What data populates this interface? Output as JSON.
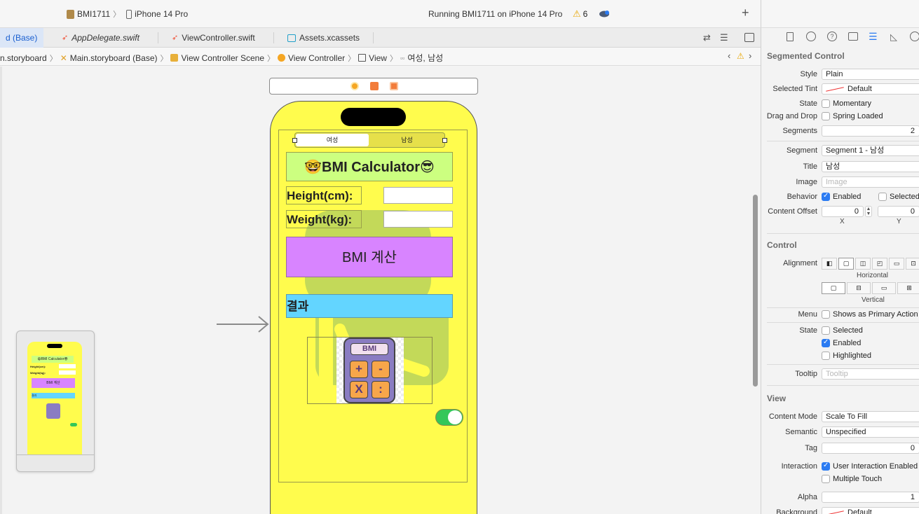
{
  "toolbar": {
    "project": "BMI1711",
    "device": "iPhone 14 Pro",
    "status": "Running BMI1711 on iPhone 14 Pro",
    "warning_count": "6",
    "add_label": "+"
  },
  "tabs": [
    {
      "label": "d (Base)"
    },
    {
      "label": "AppDelegate.swift"
    },
    {
      "label": "ViewController.swift"
    },
    {
      "label": "Assets.xcassets"
    }
  ],
  "breadcrumb": [
    "n.storyboard",
    "Main.storyboard (Base)",
    "View Controller Scene",
    "View Controller",
    "View",
    "여성, 남성"
  ],
  "app": {
    "segments": [
      "여성",
      "남성"
    ],
    "title": "🤓BMI Calculator😎",
    "height_label": "Height(cm):",
    "weight_label": "Weight(kg):",
    "calc_button": "BMI 계산",
    "result_label": "결과",
    "calc_image_label": "BMI",
    "calc_keys": [
      "+",
      "-",
      "X",
      ":"
    ],
    "switch_on": true
  },
  "thumbnail": {
    "title": "😃BMI Calculator😎",
    "height_label": "Height(cm):",
    "weight_label": "Weight(kg):",
    "calc_button": "BMI 계산",
    "result_label": "결과"
  },
  "inspector": {
    "section_segmented": "Segmented Control",
    "style_label": "Style",
    "style_value": "Plain",
    "tint_label": "Selected Tint",
    "tint_value": "Default",
    "state_label": "State",
    "state_value": "Momentary",
    "dnd_label": "Drag and Drop",
    "dnd_value": "Spring Loaded",
    "segments_label": "Segments",
    "segments_value": "2",
    "segment_label": "Segment",
    "segment_value": "Segment 1 - 남성",
    "title_label": "Title",
    "title_value": "남성",
    "image_label": "Image",
    "image_placeholder": "Image",
    "behavior_label": "Behavior",
    "behavior_enabled": "Enabled",
    "behavior_selected": "Selected",
    "offset_label": "Content Offset",
    "offset_x": "0",
    "offset_y": "0",
    "offset_x_caption": "X",
    "offset_y_caption": "Y",
    "section_control": "Control",
    "alignment_label": "Alignment",
    "horizontal_caption": "Horizontal",
    "vertical_caption": "Vertical",
    "menu_label": "Menu",
    "menu_value": "Shows as Primary Action",
    "cstate_label": "State",
    "cstate_selected": "Selected",
    "cstate_enabled": "Enabled",
    "cstate_highlighted": "Highlighted",
    "tooltip_label": "Tooltip",
    "tooltip_placeholder": "Tooltip",
    "section_view": "View",
    "content_mode_label": "Content Mode",
    "content_mode_value": "Scale To Fill",
    "semantic_label": "Semantic",
    "semantic_value": "Unspecified",
    "tag_label": "Tag",
    "tag_value": "0",
    "interaction_label": "Interaction",
    "interaction_user": "User Interaction Enabled",
    "interaction_multi": "Multiple Touch",
    "alpha_label": "Alpha",
    "alpha_value": "1",
    "background_label": "Background",
    "background_value": "Default"
  },
  "colors": {
    "phone_bg": "#fffc4d",
    "title_bg": "#ccff80",
    "calc_btn_bg": "#d884ff",
    "result_bg": "#63d5ff",
    "switch_on": "#34c759",
    "accent": "#2b7bf2"
  }
}
